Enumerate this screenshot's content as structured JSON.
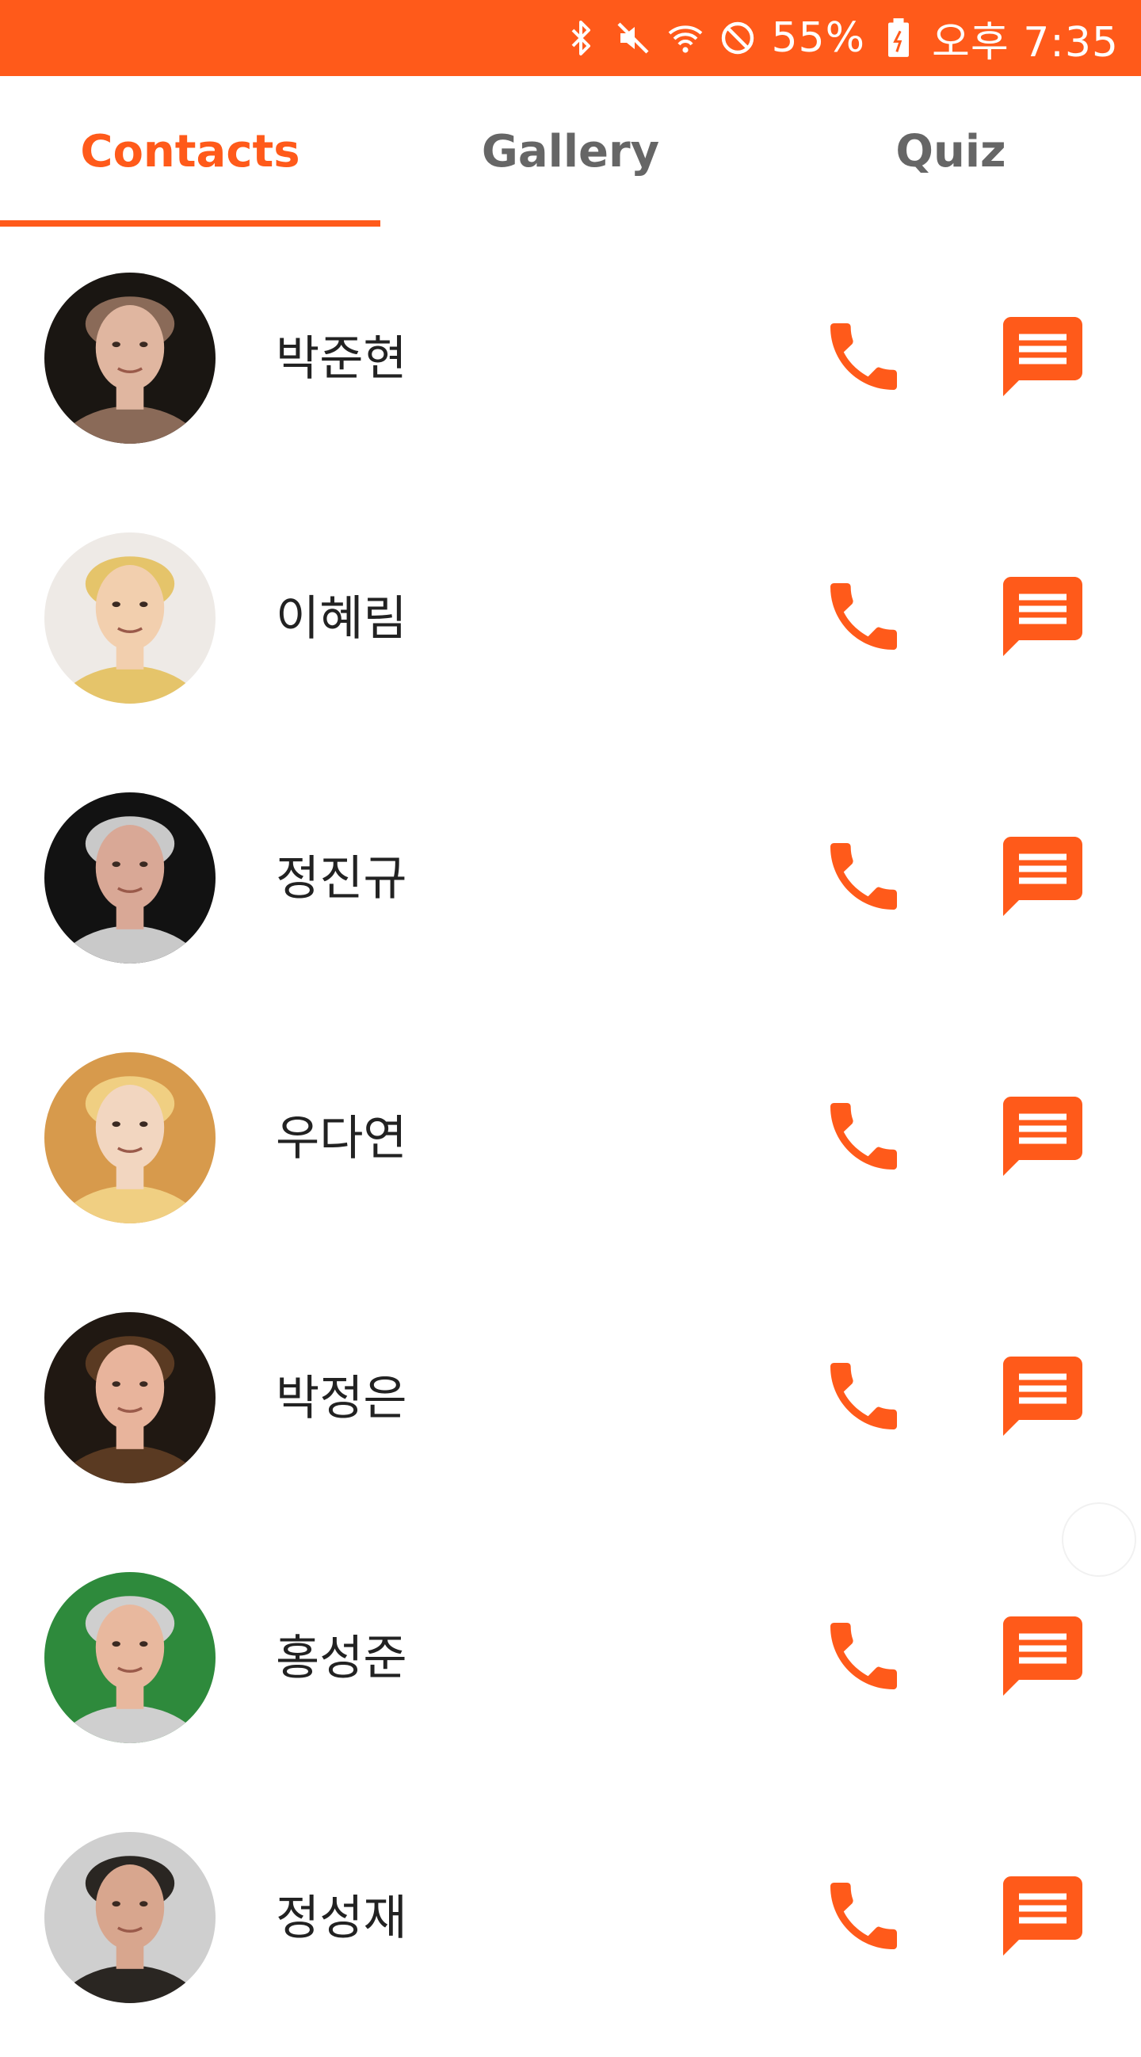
{
  "status_bar": {
    "battery_percent": "55%",
    "time": "오후 7:35",
    "icons": [
      "bluetooth-icon",
      "mute-icon",
      "wifi-icon",
      "do-not-disturb-icon",
      "battery-icon"
    ]
  },
  "tabs": [
    {
      "label": "Contacts",
      "active": true
    },
    {
      "label": "Gallery",
      "active": false
    },
    {
      "label": "Quiz",
      "active": false
    }
  ],
  "contacts": [
    {
      "name": "박준현",
      "avatar_colors": [
        "#1a1612",
        "#e0b6a0",
        "#8a6a58"
      ]
    },
    {
      "name": "이혜림",
      "avatar_colors": [
        "#eeeae6",
        "#f2cfae",
        "#e5c46a"
      ]
    },
    {
      "name": "정진규",
      "avatar_colors": [
        "#121212",
        "#d9a896",
        "#c9c9c9"
      ]
    },
    {
      "name": "우다연",
      "avatar_colors": [
        "#d79a4c",
        "#f2d6c0",
        "#f0cf82"
      ]
    },
    {
      "name": "박정은",
      "avatar_colors": [
        "#201812",
        "#e8b49c",
        "#5a3a22"
      ]
    },
    {
      "name": "홍성준",
      "avatar_colors": [
        "#2e8a3c",
        "#e8b89e",
        "#cfcfcf"
      ]
    },
    {
      "name": "정성재",
      "avatar_colors": [
        "#cfcfcf",
        "#d8a68e",
        "#2a2622"
      ]
    }
  ],
  "colors": {
    "accent": "#ff5a1a",
    "tab_inactive": "#666666",
    "name_text": "#222222"
  },
  "icons": {
    "call": "phone-icon",
    "message": "chat-bubble-icon"
  }
}
